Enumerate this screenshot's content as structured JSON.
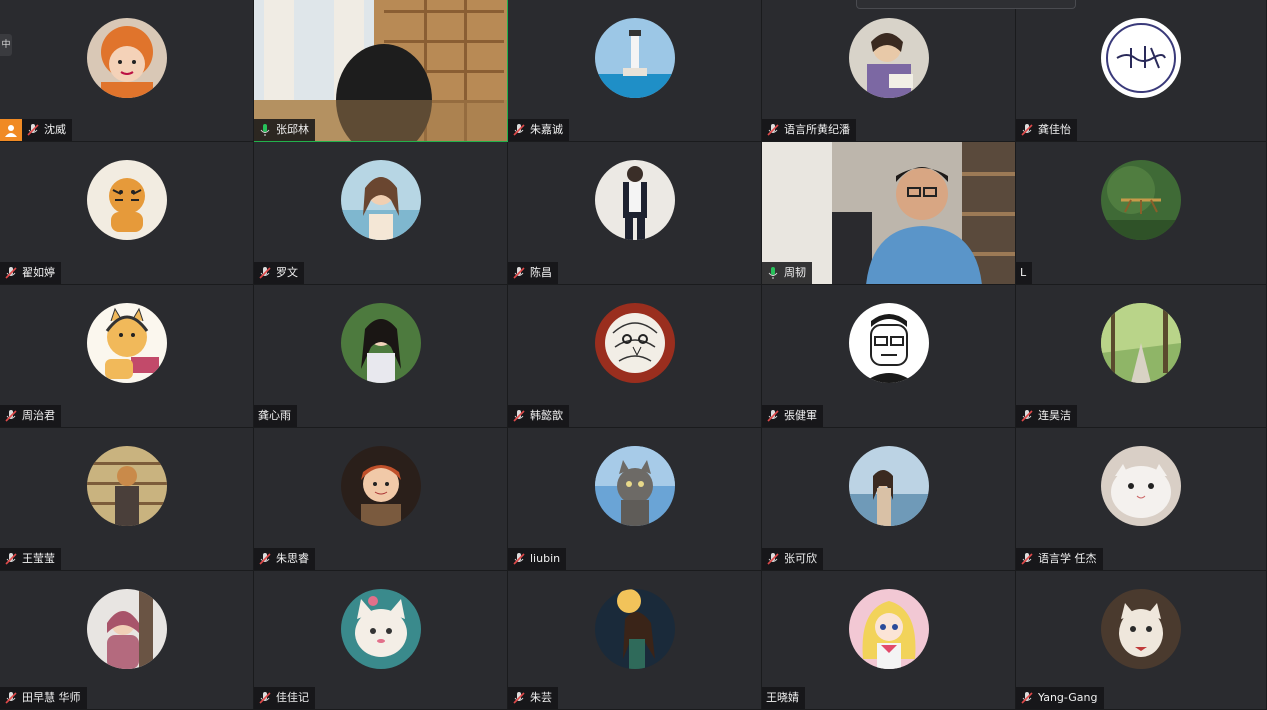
{
  "left_edge_label": "中",
  "colors": {
    "tile_bg": "#2a2b2f",
    "active_speaker_border": "#22b14c",
    "mic_muted": "#e04a4a",
    "mic_active": "#27c25a",
    "host_badge": "#f08a24"
  },
  "participants": [
    {
      "name": "沈威",
      "mic": "muted",
      "host": true,
      "avatar": "child-orange-hat"
    },
    {
      "name": "张邱林",
      "mic": "active",
      "speaking": true,
      "video": "bookshelf-room"
    },
    {
      "name": "朱嘉诚",
      "mic": "muted",
      "avatar": "lighthouse"
    },
    {
      "name": "语言所黄纪潘",
      "mic": "muted",
      "avatar": "reading-girl"
    },
    {
      "name": "龚佳怡",
      "mic": "muted",
      "avatar": "calligraphy-logo"
    },
    {
      "name": "翟如婷",
      "mic": "muted",
      "avatar": "tiger-painting"
    },
    {
      "name": "罗文",
      "mic": "muted",
      "avatar": "beach-woman"
    },
    {
      "name": "陈昌",
      "mic": "muted",
      "avatar": "standing-man"
    },
    {
      "name": "周韧",
      "mic": "active",
      "video": "office-man-glasses"
    },
    {
      "name": "L",
      "mic": "none",
      "avatar": "green-insect"
    },
    {
      "name": "周治君",
      "mic": "muted",
      "avatar": "cartoon-cat-laptop"
    },
    {
      "name": "龚心雨",
      "mic": "none",
      "avatar": "girl-green-background"
    },
    {
      "name": "韩懿歆",
      "mic": "muted",
      "avatar": "bird-sketch"
    },
    {
      "name": "張健軍",
      "mic": "muted",
      "avatar": "cartoon-man-glasses"
    },
    {
      "name": "连昊洁",
      "mic": "muted",
      "avatar": "tree-road"
    },
    {
      "name": "王莹莹",
      "mic": "muted",
      "avatar": "bookshelf-person"
    },
    {
      "name": "朱思睿",
      "mic": "muted",
      "avatar": "redhead-boy"
    },
    {
      "name": "liubin",
      "mic": "muted",
      "avatar": "grumpy-cat"
    },
    {
      "name": "张可欣",
      "mic": "muted",
      "avatar": "seaside-woman"
    },
    {
      "name": "语言学 任杰",
      "mic": "muted",
      "avatar": "fluffy-animal"
    },
    {
      "name": "田早慧 华师",
      "mic": "muted",
      "avatar": "snow-girl"
    },
    {
      "name": "佳佳记",
      "mic": "muted",
      "avatar": "cartoon-white-cat"
    },
    {
      "name": "朱芸",
      "mic": "muted",
      "avatar": "golden-woman"
    },
    {
      "name": "王晓婧",
      "mic": "none",
      "avatar": "anime-girl"
    },
    {
      "name": "Yang-Gang",
      "mic": "muted",
      "avatar": "cat-figurine"
    }
  ]
}
